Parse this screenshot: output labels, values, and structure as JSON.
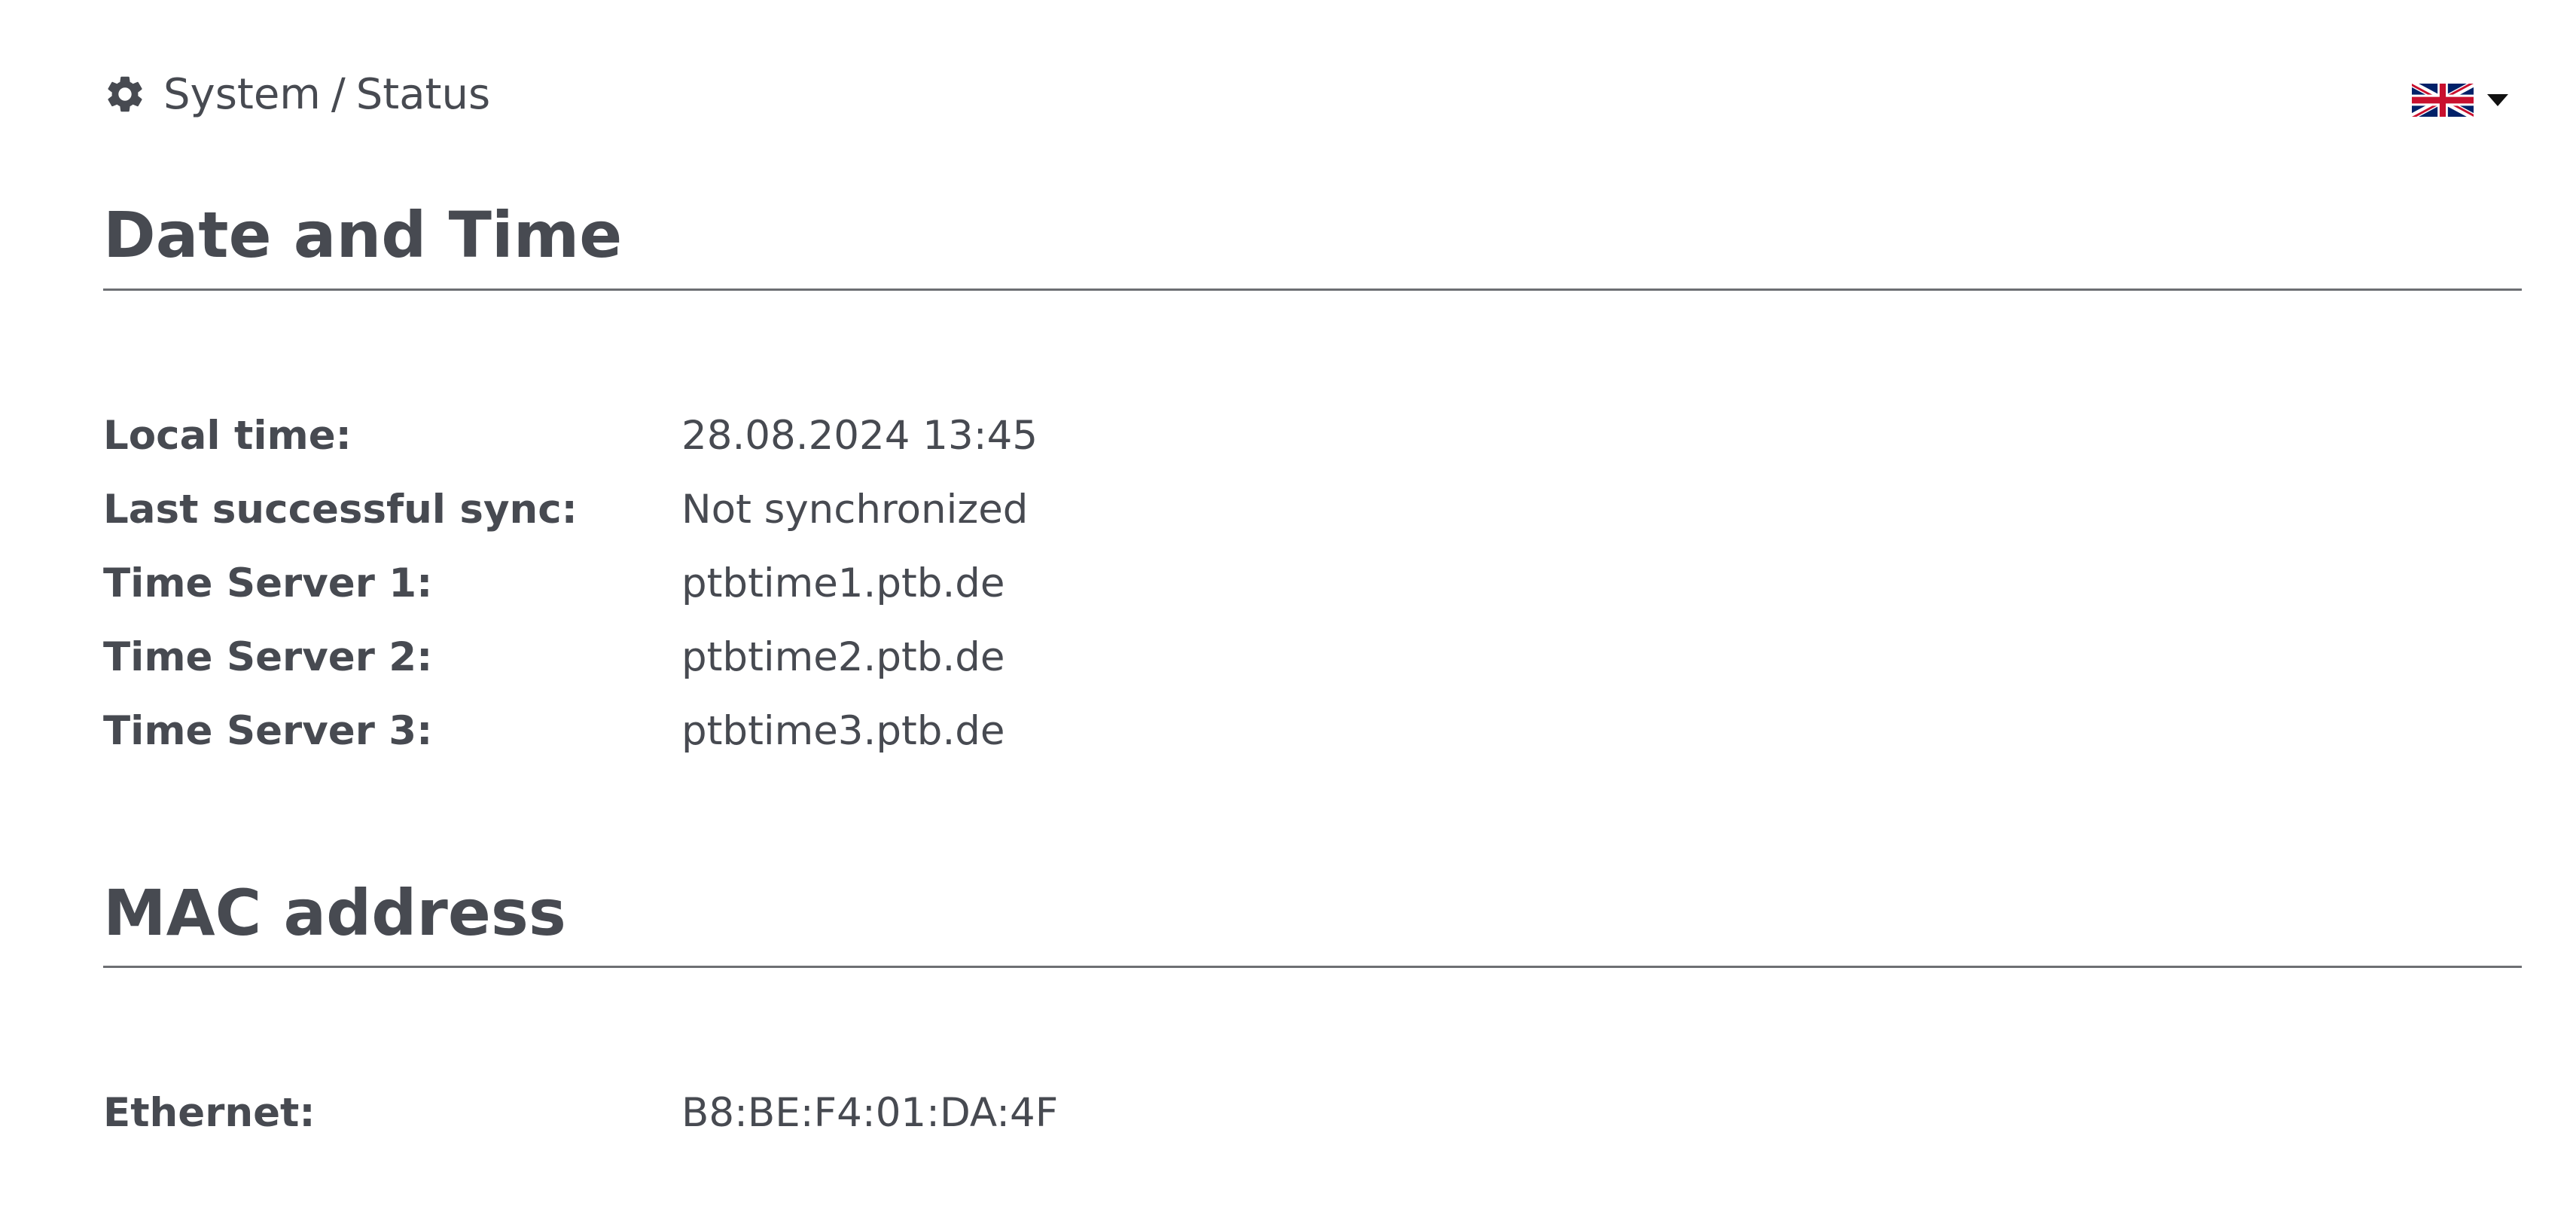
{
  "header": {
    "breadcrumb": {
      "icon": "gear-icon",
      "section": "System",
      "separator": "/",
      "page": "Status"
    },
    "language": {
      "selected": "English (UK)",
      "icon": "uk-flag-icon",
      "caret_icon": "caret-down-icon"
    }
  },
  "date_time": {
    "title": "Date and Time",
    "rows": [
      {
        "label": "Local time:",
        "value": "28.08.2024 13:45"
      },
      {
        "label": "Last successful sync:",
        "value": "Not synchronized"
      },
      {
        "label": "Time Server 1:",
        "value": "ptbtime1.ptb.de"
      },
      {
        "label": "Time Server 2:",
        "value": "ptbtime2.ptb.de"
      },
      {
        "label": "Time Server 3:",
        "value": "ptbtime3.ptb.de"
      }
    ]
  },
  "mac": {
    "title": "MAC address",
    "rows": [
      {
        "label": "Ethernet:",
        "value": "B8:BE:F4:01:DA:4F"
      }
    ]
  },
  "colors": {
    "text": "#474a51",
    "rule": "#6d6f73",
    "background": "#ffffff"
  }
}
